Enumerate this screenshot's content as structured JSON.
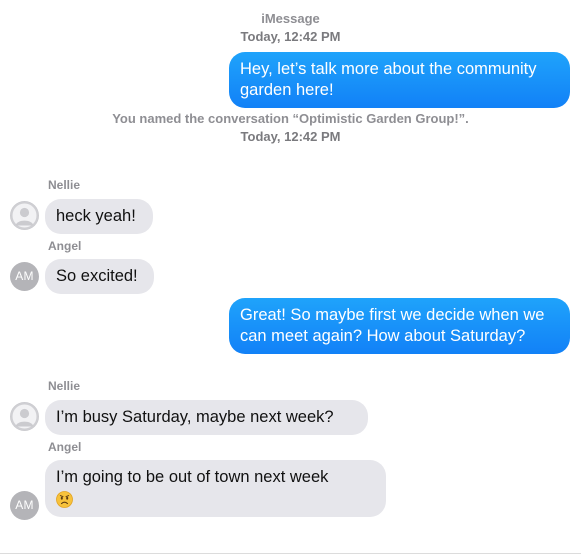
{
  "header": {
    "service": "iMessage",
    "time": "Today, 12:42 PM"
  },
  "system_event": {
    "text": "You named the conversation “Optimistic Garden Group!”.",
    "time": "Today, 12:42 PM"
  },
  "messages": [
    {
      "direction": "out",
      "text": "Hey, let’s talk more about the community garden here!"
    },
    {
      "direction": "in",
      "sender": "Nellie",
      "avatar": "person-silhouette-icon",
      "text": "heck yeah!"
    },
    {
      "direction": "in",
      "sender": "Angel",
      "avatar_initials": "AM",
      "text": "So excited!"
    },
    {
      "direction": "out",
      "text": "Great!  So maybe first we decide when we can meet again?  How about Saturday?"
    },
    {
      "direction": "in",
      "sender": "Nellie",
      "avatar": "person-silhouette-icon",
      "text": "I’m busy Saturday, maybe next week?"
    },
    {
      "direction": "in",
      "sender": "Angel",
      "avatar_initials": "AM",
      "text": "I’m going to be out of town next week",
      "emoji": "worried-face-emoji"
    }
  ],
  "colors": {
    "outgoing_bubble": "#1281f7",
    "incoming_bubble": "#e6e6eb",
    "meta_text": "#8e8e93"
  }
}
